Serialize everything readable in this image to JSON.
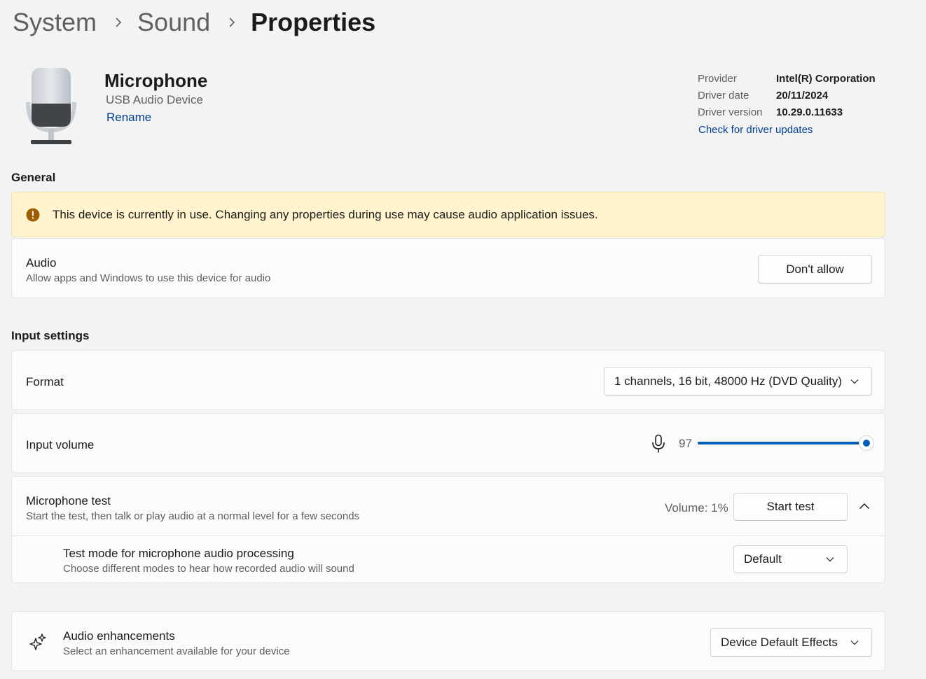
{
  "breadcrumb": {
    "items": [
      "System",
      "Sound",
      "Properties"
    ]
  },
  "device": {
    "name": "Microphone",
    "subtitle": "USB Audio Device",
    "rename_label": "Rename",
    "icon": "microphone-device-icon"
  },
  "driver": {
    "provider_label": "Provider",
    "provider_value": "Intel(R) Corporation",
    "date_label": "Driver date",
    "date_value": "20/11/2024",
    "version_label": "Driver version",
    "version_value": "10.29.0.11633",
    "update_link": "Check for driver updates"
  },
  "general": {
    "heading": "General",
    "warning_text": "This device is currently in use. Changing any properties during use may cause audio application issues.",
    "warning_icon": "alert-circle-icon",
    "audio_title": "Audio",
    "audio_subtitle": "Allow apps and Windows to use this device for audio",
    "audio_button": "Don't allow"
  },
  "input_settings": {
    "heading": "Input settings",
    "format_label": "Format",
    "format_value": "1 channels, 16 bit, 48000 Hz (DVD Quality)",
    "volume_label": "Input volume",
    "volume_value": "97",
    "volume_fraction": 0.97,
    "volume_icon": "microphone-icon",
    "mic_test_title": "Microphone test",
    "mic_test_subtitle": "Start the test, then talk or play audio at a normal level for a few seconds",
    "mic_test_volume": "Volume: 1%",
    "start_test_button": "Start test",
    "test_mode_title": "Test mode for microphone audio processing",
    "test_mode_subtitle": "Choose different modes to hear how recorded audio will sound",
    "test_mode_value": "Default",
    "enhancements_title": "Audio enhancements",
    "enhancements_subtitle": "Select an enhancement available for your device",
    "enhancements_value": "Device Default Effects",
    "enhancements_icon": "sparkle-icon"
  },
  "colors": {
    "accent": "#005fb8",
    "link": "#003e92",
    "warning_bg": "#fff4ce",
    "warning_icon": "#9d5d00"
  }
}
